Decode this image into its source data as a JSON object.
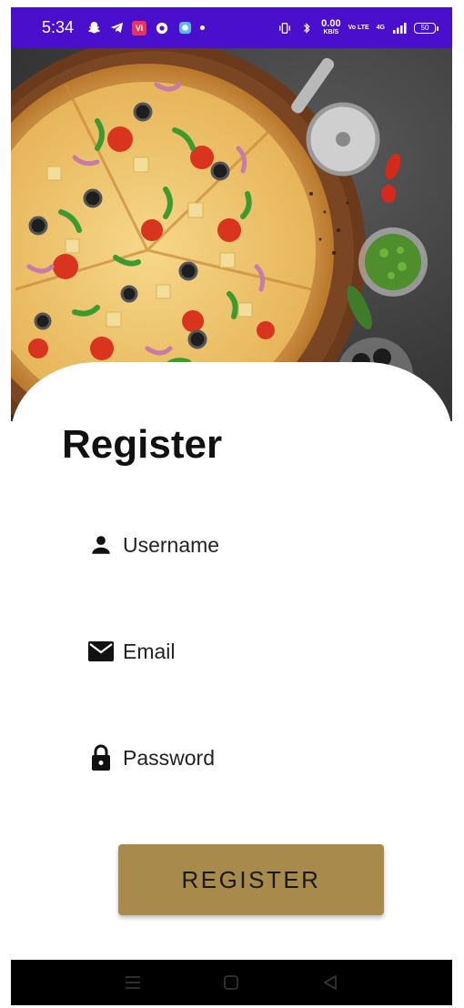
{
  "status_bar": {
    "time": "5:34",
    "carrier_badge": "Vi",
    "speed_value": "0.00",
    "speed_unit": "KB/S",
    "volte": "Vo LTE",
    "network": "4G",
    "battery": "50",
    "background_color": "#4a0fcc"
  },
  "hero": {
    "icon": "pizza-image"
  },
  "form": {
    "title": "Register",
    "fields": [
      {
        "icon": "person-icon",
        "placeholder": "Username",
        "value": ""
      },
      {
        "icon": "mail-icon",
        "placeholder": "Email",
        "value": ""
      },
      {
        "icon": "lock-icon",
        "placeholder": "Password",
        "value": ""
      }
    ],
    "submit_label": "REGISTER",
    "button_color": "#a88a4c"
  },
  "nav_bar": {
    "items": [
      "menu-icon",
      "home-icon",
      "back-icon"
    ]
  }
}
